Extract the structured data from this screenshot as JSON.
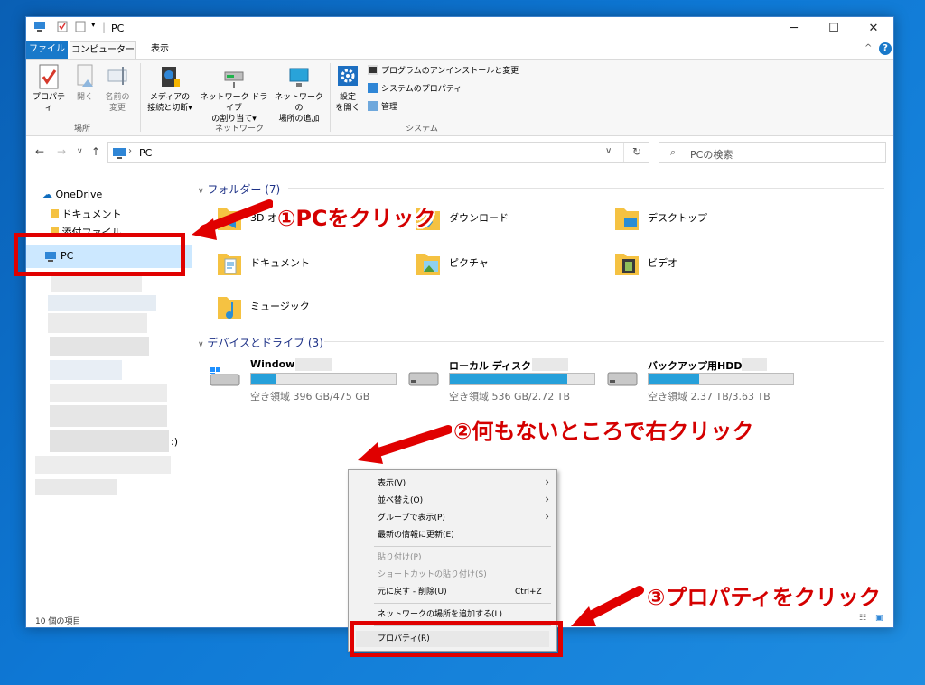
{
  "window": {
    "title": "PC",
    "minimize": "─",
    "maximize": "☐",
    "close": "✕"
  },
  "tabs": {
    "file": "ファイル",
    "computer": "コンピューター",
    "view": "表示"
  },
  "ribbon": {
    "properties": "プロパティ",
    "open": "開く",
    "rename_1": "名前の",
    "rename_2": "変更",
    "group_location": "場所",
    "media_1": "メディアの",
    "media_2": "接続と切断",
    "netdrive_1": "ネットワーク ドライブ",
    "netdrive_2": "の割り当て",
    "netloc_1": "ネットワークの",
    "netloc_2": "場所の追加",
    "group_network": "ネットワーク",
    "settings_1": "設定",
    "settings_2": "を開く",
    "uninstall": "プログラムのアンインストールと変更",
    "sysprops": "システムのプロパティ",
    "manage": "管理",
    "group_system": "システム"
  },
  "address": {
    "path": "PC",
    "search_placeholder": "PCの検索"
  },
  "sidebar": {
    "onedrive": "OneDrive",
    "documents": "ドキュメント",
    "attachments": "添付ファイル",
    "pc": "PC",
    "drive_suffix": ":)"
  },
  "folders": {
    "header": "フォルダー (7)",
    "items": [
      "3D オ",
      "ダウンロード",
      "デスクトップ",
      "ドキュメント",
      "ピクチャ",
      "ビデオ",
      "ミュージック"
    ]
  },
  "drives": {
    "header": "デバイスとドライブ (3)",
    "items": [
      {
        "name": "Window",
        "free": "空き領域 396 GB/475 GB",
        "used_fraction": 0.17
      },
      {
        "name": "ローカル ディスク",
        "free": "空き領域 536 GB/2.72 TB",
        "used_fraction": 0.81
      },
      {
        "name": "バックアップ用HDD",
        "free": "空き領域 2.37 TB/3.63 TB",
        "used_fraction": 0.35
      }
    ]
  },
  "status": {
    "count": "10 個の項目"
  },
  "context_menu": {
    "view": "表示(V)",
    "sort": "並べ替え(O)",
    "group": "グループで表示(P)",
    "refresh": "最新の情報に更新(E)",
    "paste": "貼り付け(P)",
    "paste_shortcut": "ショートカットの貼り付け(S)",
    "undo": "元に戻す - 削除(U)",
    "undo_key": "Ctrl+Z",
    "add_netloc": "ネットワークの場所を追加する(L)",
    "properties": "プロパティ(R)"
  },
  "annotations": {
    "step1": "①PCをクリック",
    "step2": "②何もないところで右クリック",
    "step3": "③プロパティをクリック"
  },
  "colors": {
    "accent": "#1979ca",
    "annotation": "#e00000",
    "drive_bar": "#26a0da"
  }
}
